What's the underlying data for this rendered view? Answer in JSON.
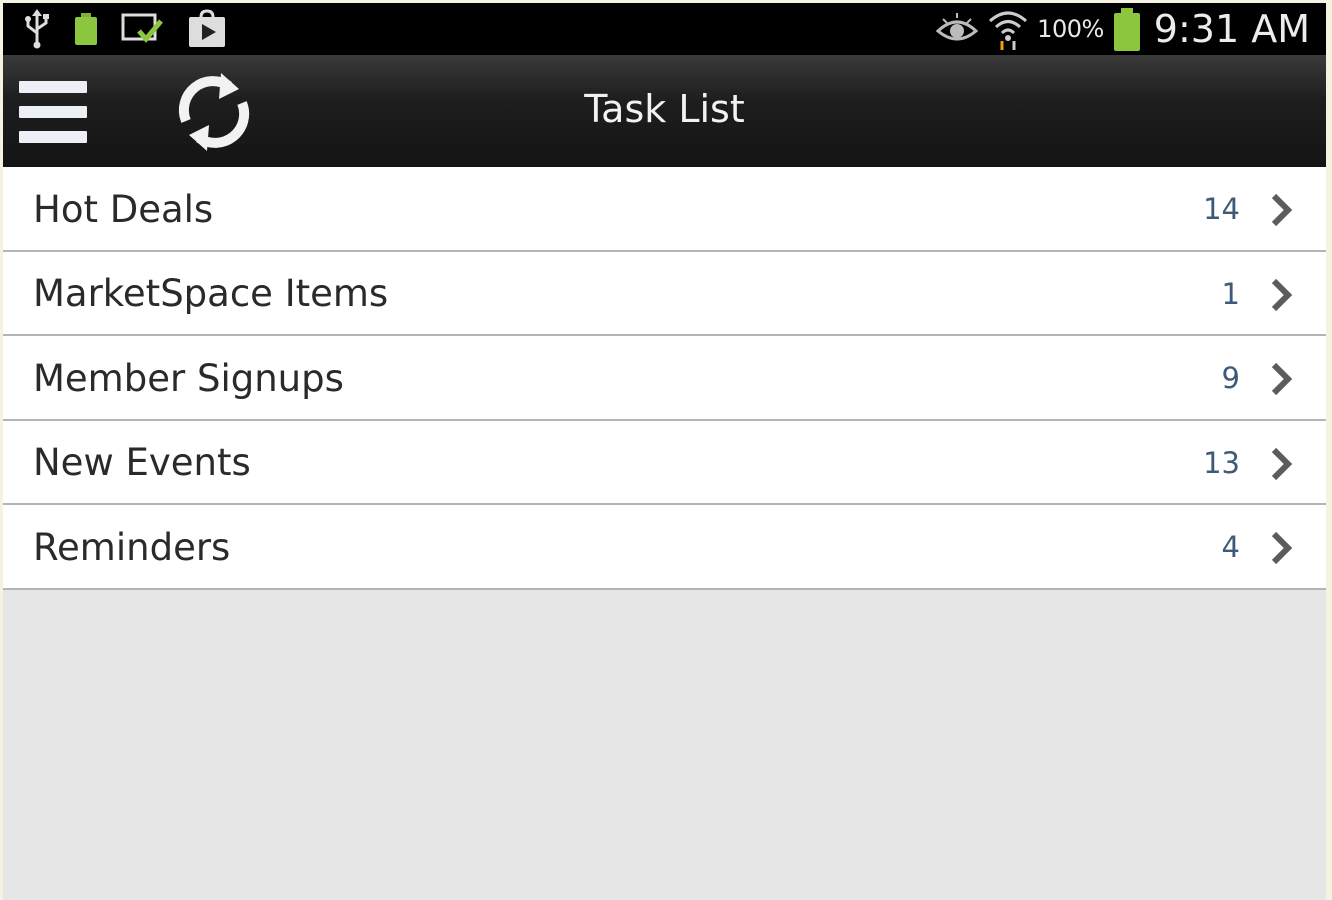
{
  "status_bar": {
    "icons_left": [
      "usb-icon",
      "battery-small-icon",
      "screen-check-icon",
      "play-store-icon"
    ],
    "icons_right": [
      "eye-icon",
      "wifi-icon",
      "battery-icon"
    ],
    "battery_percent": "100%",
    "time": "9:31 AM",
    "battery_color": "#8cc63f"
  },
  "action_bar": {
    "title": "Task List",
    "menu_icon": "hamburger-menu-icon",
    "refresh_icon": "refresh-icon"
  },
  "task_list": {
    "items": [
      {
        "label": "Hot Deals",
        "count": "14"
      },
      {
        "label": "MarketSpace Items",
        "count": "1"
      },
      {
        "label": "Member Signups",
        "count": "9"
      },
      {
        "label": "New Events",
        "count": "13"
      },
      {
        "label": "Reminders",
        "count": "4"
      }
    ]
  },
  "colors": {
    "count_text": "#3d5a78",
    "background": "#e6e6e6",
    "row_background": "#ffffff"
  }
}
